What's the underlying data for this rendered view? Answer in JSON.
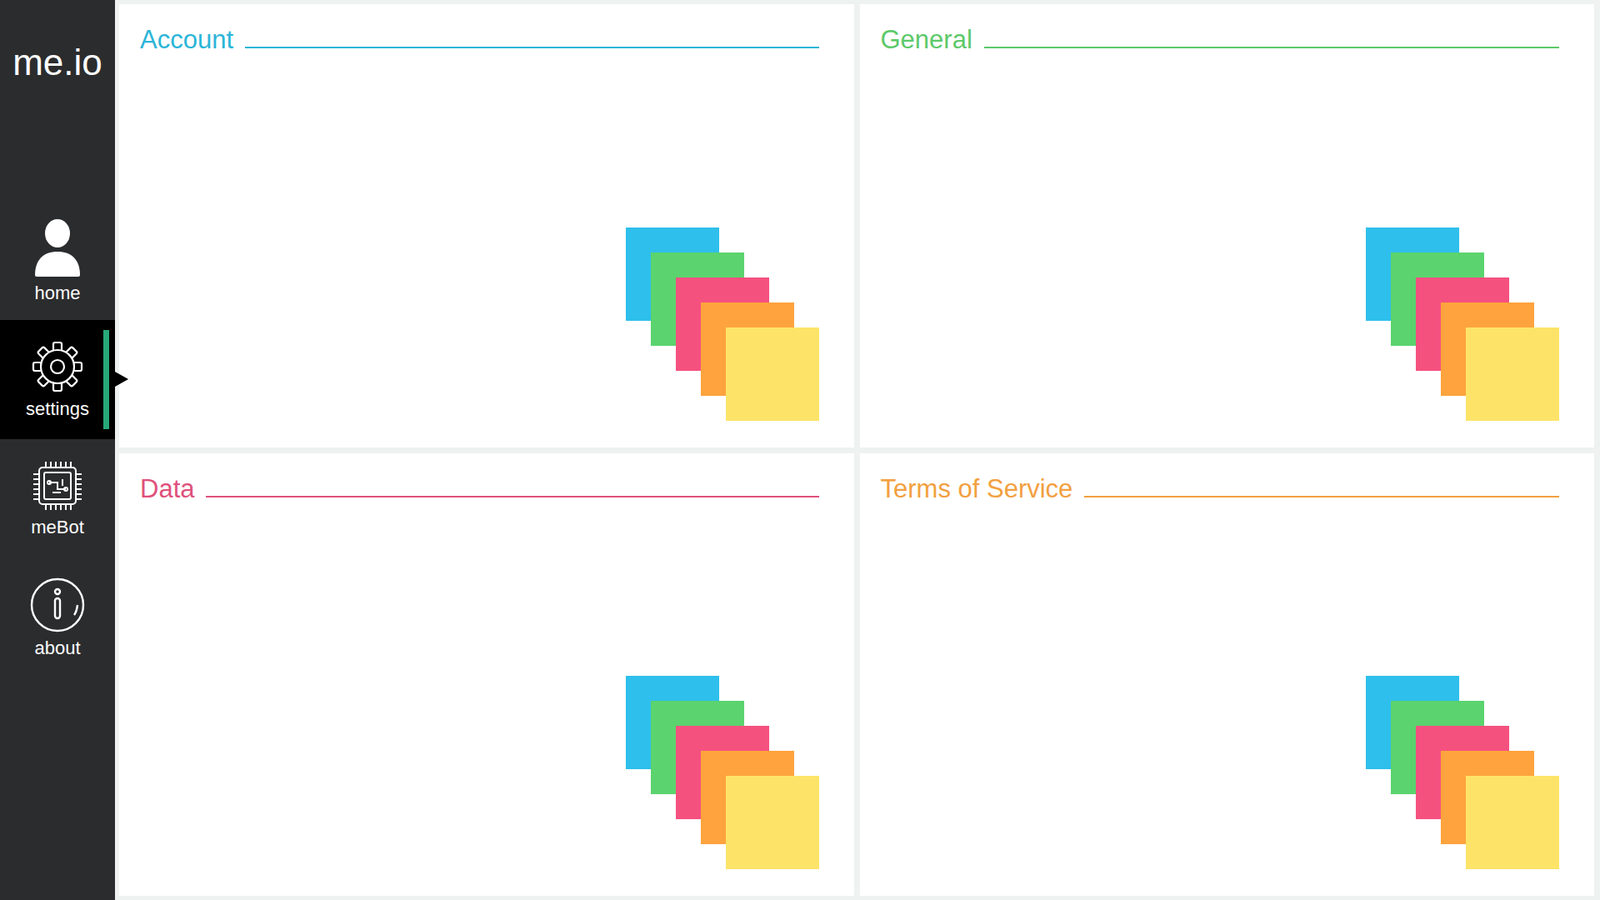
{
  "logo": "me.io",
  "sidebar": {
    "items": [
      {
        "label": "home",
        "selected": false,
        "kind": "home"
      },
      {
        "label": "settings",
        "selected": true,
        "kind": "settings"
      },
      {
        "label": "meBot",
        "selected": false,
        "kind": "bot"
      },
      {
        "label": "about",
        "selected": false,
        "kind": "about"
      }
    ]
  },
  "panels": [
    {
      "title": "Account",
      "color": "#2bb5d8"
    },
    {
      "title": "General",
      "color": "#5cc96a"
    },
    {
      "title": "Data",
      "color": "#e0507b"
    },
    {
      "title": "Terms of Service",
      "color": "#f2a040"
    }
  ]
}
